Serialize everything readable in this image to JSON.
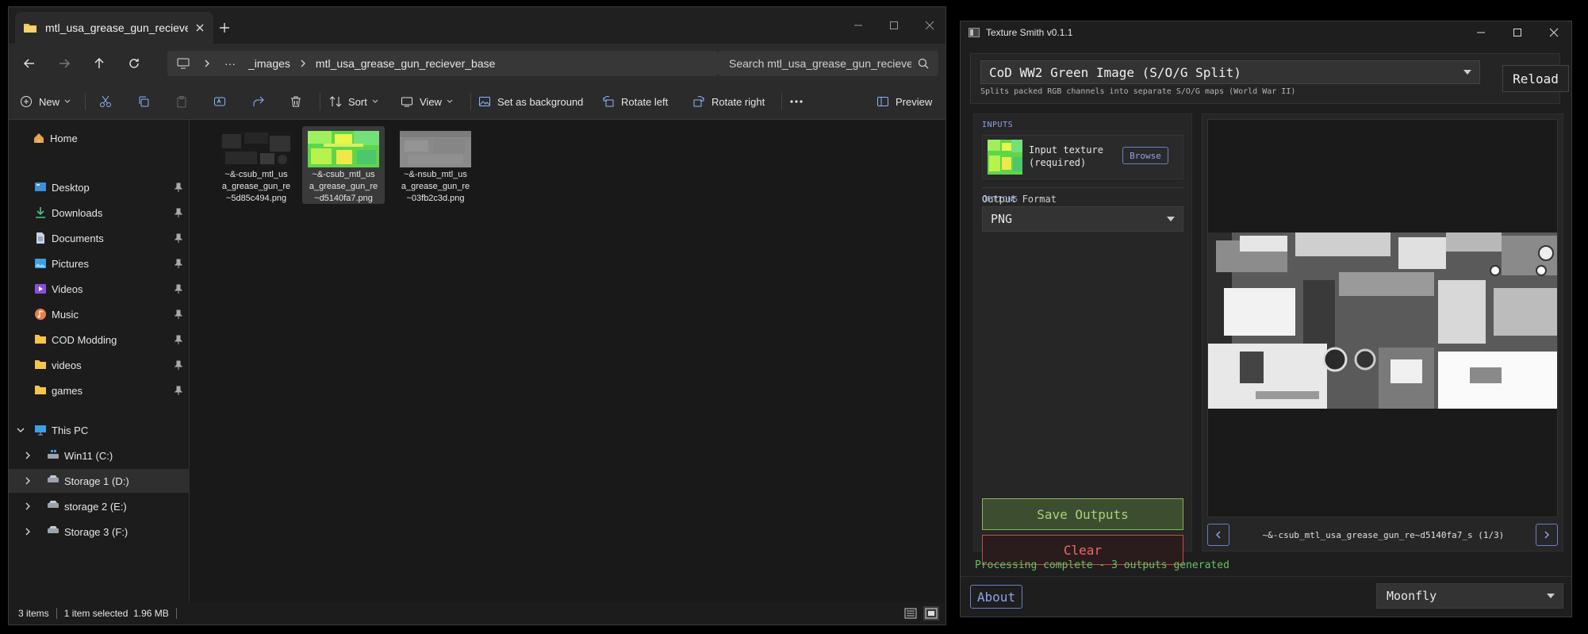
{
  "explorer": {
    "tab_title": "mtl_usa_grease_gun_reciever_",
    "address": {
      "dots": "···",
      "crumbs": [
        "_images",
        "mtl_usa_grease_gun_reciever_base"
      ]
    },
    "search_placeholder": "Search mtl_usa_grease_gun_recieve",
    "toolbar": {
      "new": "New",
      "sort": "Sort",
      "view": "View",
      "set_background": "Set as background",
      "rotate_left": "Rotate left",
      "rotate_right": "Rotate right",
      "preview": "Preview"
    },
    "sidebar": {
      "home": "Home",
      "quick": [
        {
          "label": "Desktop",
          "icon": "desktop-icon"
        },
        {
          "label": "Downloads",
          "icon": "download-icon"
        },
        {
          "label": "Documents",
          "icon": "document-icon"
        },
        {
          "label": "Pictures",
          "icon": "pictures-icon"
        },
        {
          "label": "Videos",
          "icon": "videos-icon"
        },
        {
          "label": "Music",
          "icon": "music-icon"
        },
        {
          "label": "COD Modding",
          "icon": "folder-icon"
        },
        {
          "label": "videos",
          "icon": "folder-icon"
        },
        {
          "label": "games",
          "icon": "folder-icon"
        }
      ],
      "this_pc": "This PC",
      "drives": [
        "Win11 (C:)",
        "Storage 1 (D:)",
        "storage 2 (E:)",
        "Storage 3 (F:)"
      ]
    },
    "files": [
      {
        "name": "~&-csub_mtl_usa_grease_gun_re~5d85c494.png",
        "lines": [
          "~&-csub_mtl_us",
          "a_grease_gun_re",
          "~5d85c494.png"
        ]
      },
      {
        "name": "~&-csub_mtl_usa_grease_gun_re~d5140fa7.png",
        "lines": [
          "~&-csub_mtl_us",
          "a_grease_gun_re",
          "~d5140fa7.png"
        ]
      },
      {
        "name": "~&-nsub_mtl_usa_grease_gun_re~03fb2c3d.png",
        "lines": [
          "~&-nsub_mtl_us",
          "a_grease_gun_re",
          "~03fb2c3d.png"
        ]
      }
    ],
    "status": {
      "items": "3 items",
      "selected": "1 item selected  1.96 MB"
    }
  },
  "texture_smith": {
    "title": "Texture Smith v0.1.1",
    "profile": "CoD WW2 Green Image (S/O/G Split)",
    "profile_desc": "Splits packed RGB channels into separate S/O/G maps (World War II)",
    "reload": "Reload",
    "inputs_label": "INPUTS",
    "input_texture_line1": "Input texture",
    "input_texture_line2": "(required)",
    "browse": "Browse",
    "options_label": "OPTIONS",
    "output_format_label": "Output Format",
    "output_format": "PNG",
    "save": "Save Outputs",
    "clear": "Clear",
    "preview_caption": "~&-csub_mtl_usa_grease_gun_re~d5140fa7_s (1/3)",
    "status": "Processing complete - 3 outputs generated",
    "about": "About",
    "theme": "Moonfly"
  },
  "colors": {
    "accent_blue": "#8ea3e8",
    "save_green": "#a8d17a",
    "clear_red": "#ef6a6a",
    "status_green": "#62c462"
  }
}
